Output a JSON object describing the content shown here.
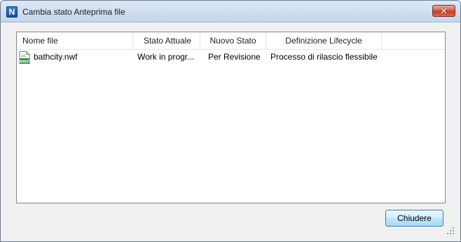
{
  "window": {
    "title": "Cambia stato Anteprima file",
    "app_icon_letter": "N",
    "close_symbol": "✕"
  },
  "list": {
    "columns": [
      "Nome file",
      "Stato Attuale",
      "Nuovo Stato",
      "Definizione Lifecycle"
    ],
    "rows": [
      {
        "file_name": "bathcity.nwf",
        "file_icon": "nwf-file-icon",
        "current_state": "Work in progr...",
        "new_state": "Per Revisione",
        "lifecycle": "Processo di rilascio flessibile"
      }
    ]
  },
  "buttons": {
    "close_label": "Chiudere"
  },
  "colors": {
    "title_bar": "#c4d6ec",
    "close_button": "#c13a22",
    "button_border": "#3c7fb1",
    "file_icon_green": "#2e8b3e"
  }
}
